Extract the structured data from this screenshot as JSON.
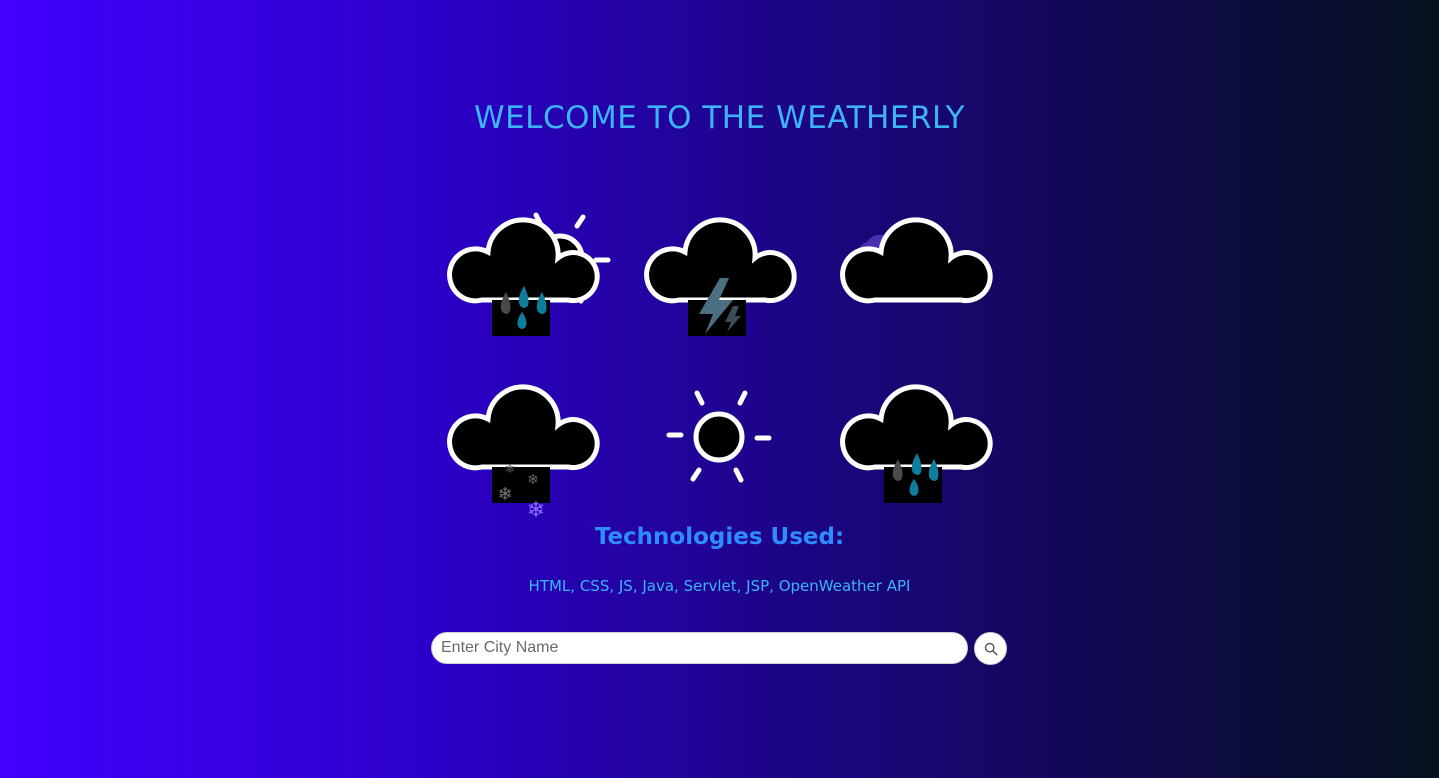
{
  "header": {
    "title": "WELCOME TO THE WEATHERLY"
  },
  "weather_icons": [
    {
      "name": "sun-cloud-rain-icon"
    },
    {
      "name": "thunderstorm-icon"
    },
    {
      "name": "cloudy-icon"
    },
    {
      "name": "snow-icon"
    },
    {
      "name": "sun-icon"
    },
    {
      "name": "rain-icon"
    }
  ],
  "technologies": {
    "heading": "Technologies Used:",
    "list": "HTML, CSS, JS, Java, Servlet, JSP, OpenWeather API"
  },
  "search": {
    "placeholder": "Enter City Name",
    "value": "",
    "button_icon": "search-icon"
  },
  "colors": {
    "title": "#3cb4f7",
    "heading": "#2f8cff",
    "raindrop": "#0f7d9c",
    "bolt": "#4b6f80",
    "snowflake": "#8a6cff"
  }
}
